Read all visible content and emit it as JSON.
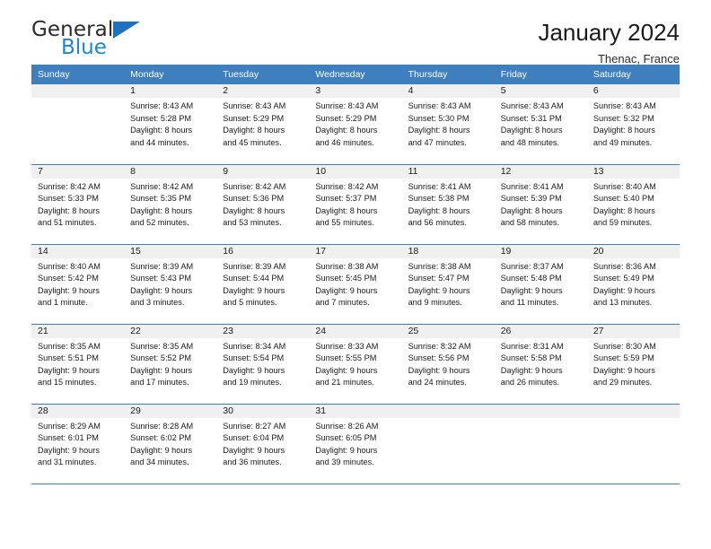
{
  "brand": {
    "name_top": "General",
    "name_bottom": "Blue",
    "flag_color": "#1f72bd",
    "blue_text_color": "#1f86d0"
  },
  "header": {
    "title": "January 2024",
    "subtitle": "Thenac, France"
  },
  "theme": {
    "header_row_bg": "#3d7fbf",
    "daynum_bg": "#f0f0f0",
    "grid_line": "#3d7fbf"
  },
  "calendar": {
    "weekday_headers": [
      "Sunday",
      "Monday",
      "Tuesday",
      "Wednesday",
      "Thursday",
      "Friday",
      "Saturday"
    ],
    "weeks": [
      [
        {
          "day": "",
          "lines": []
        },
        {
          "day": "1",
          "lines": [
            "Sunrise: 8:43 AM",
            "Sunset: 5:28 PM",
            "Daylight: 8 hours",
            "and 44 minutes."
          ]
        },
        {
          "day": "2",
          "lines": [
            "Sunrise: 8:43 AM",
            "Sunset: 5:29 PM",
            "Daylight: 8 hours",
            "and 45 minutes."
          ]
        },
        {
          "day": "3",
          "lines": [
            "Sunrise: 8:43 AM",
            "Sunset: 5:29 PM",
            "Daylight: 8 hours",
            "and 46 minutes."
          ]
        },
        {
          "day": "4",
          "lines": [
            "Sunrise: 8:43 AM",
            "Sunset: 5:30 PM",
            "Daylight: 8 hours",
            "and 47 minutes."
          ]
        },
        {
          "day": "5",
          "lines": [
            "Sunrise: 8:43 AM",
            "Sunset: 5:31 PM",
            "Daylight: 8 hours",
            "and 48 minutes."
          ]
        },
        {
          "day": "6",
          "lines": [
            "Sunrise: 8:43 AM",
            "Sunset: 5:32 PM",
            "Daylight: 8 hours",
            "and 49 minutes."
          ]
        }
      ],
      [
        {
          "day": "7",
          "lines": [
            "Sunrise: 8:42 AM",
            "Sunset: 5:33 PM",
            "Daylight: 8 hours",
            "and 51 minutes."
          ]
        },
        {
          "day": "8",
          "lines": [
            "Sunrise: 8:42 AM",
            "Sunset: 5:35 PM",
            "Daylight: 8 hours",
            "and 52 minutes."
          ]
        },
        {
          "day": "9",
          "lines": [
            "Sunrise: 8:42 AM",
            "Sunset: 5:36 PM",
            "Daylight: 8 hours",
            "and 53 minutes."
          ]
        },
        {
          "day": "10",
          "lines": [
            "Sunrise: 8:42 AM",
            "Sunset: 5:37 PM",
            "Daylight: 8 hours",
            "and 55 minutes."
          ]
        },
        {
          "day": "11",
          "lines": [
            "Sunrise: 8:41 AM",
            "Sunset: 5:38 PM",
            "Daylight: 8 hours",
            "and 56 minutes."
          ]
        },
        {
          "day": "12",
          "lines": [
            "Sunrise: 8:41 AM",
            "Sunset: 5:39 PM",
            "Daylight: 8 hours",
            "and 58 minutes."
          ]
        },
        {
          "day": "13",
          "lines": [
            "Sunrise: 8:40 AM",
            "Sunset: 5:40 PM",
            "Daylight: 8 hours",
            "and 59 minutes."
          ]
        }
      ],
      [
        {
          "day": "14",
          "lines": [
            "Sunrise: 8:40 AM",
            "Sunset: 5:42 PM",
            "Daylight: 9 hours",
            "and 1 minute."
          ]
        },
        {
          "day": "15",
          "lines": [
            "Sunrise: 8:39 AM",
            "Sunset: 5:43 PM",
            "Daylight: 9 hours",
            "and 3 minutes."
          ]
        },
        {
          "day": "16",
          "lines": [
            "Sunrise: 8:39 AM",
            "Sunset: 5:44 PM",
            "Daylight: 9 hours",
            "and 5 minutes."
          ]
        },
        {
          "day": "17",
          "lines": [
            "Sunrise: 8:38 AM",
            "Sunset: 5:45 PM",
            "Daylight: 9 hours",
            "and 7 minutes."
          ]
        },
        {
          "day": "18",
          "lines": [
            "Sunrise: 8:38 AM",
            "Sunset: 5:47 PM",
            "Daylight: 9 hours",
            "and 9 minutes."
          ]
        },
        {
          "day": "19",
          "lines": [
            "Sunrise: 8:37 AM",
            "Sunset: 5:48 PM",
            "Daylight: 9 hours",
            "and 11 minutes."
          ]
        },
        {
          "day": "20",
          "lines": [
            "Sunrise: 8:36 AM",
            "Sunset: 5:49 PM",
            "Daylight: 9 hours",
            "and 13 minutes."
          ]
        }
      ],
      [
        {
          "day": "21",
          "lines": [
            "Sunrise: 8:35 AM",
            "Sunset: 5:51 PM",
            "Daylight: 9 hours",
            "and 15 minutes."
          ]
        },
        {
          "day": "22",
          "lines": [
            "Sunrise: 8:35 AM",
            "Sunset: 5:52 PM",
            "Daylight: 9 hours",
            "and 17 minutes."
          ]
        },
        {
          "day": "23",
          "lines": [
            "Sunrise: 8:34 AM",
            "Sunset: 5:54 PM",
            "Daylight: 9 hours",
            "and 19 minutes."
          ]
        },
        {
          "day": "24",
          "lines": [
            "Sunrise: 8:33 AM",
            "Sunset: 5:55 PM",
            "Daylight: 9 hours",
            "and 21 minutes."
          ]
        },
        {
          "day": "25",
          "lines": [
            "Sunrise: 8:32 AM",
            "Sunset: 5:56 PM",
            "Daylight: 9 hours",
            "and 24 minutes."
          ]
        },
        {
          "day": "26",
          "lines": [
            "Sunrise: 8:31 AM",
            "Sunset: 5:58 PM",
            "Daylight: 9 hours",
            "and 26 minutes."
          ]
        },
        {
          "day": "27",
          "lines": [
            "Sunrise: 8:30 AM",
            "Sunset: 5:59 PM",
            "Daylight: 9 hours",
            "and 29 minutes."
          ]
        }
      ],
      [
        {
          "day": "28",
          "lines": [
            "Sunrise: 8:29 AM",
            "Sunset: 6:01 PM",
            "Daylight: 9 hours",
            "and 31 minutes."
          ]
        },
        {
          "day": "29",
          "lines": [
            "Sunrise: 8:28 AM",
            "Sunset: 6:02 PM",
            "Daylight: 9 hours",
            "and 34 minutes."
          ]
        },
        {
          "day": "30",
          "lines": [
            "Sunrise: 8:27 AM",
            "Sunset: 6:04 PM",
            "Daylight: 9 hours",
            "and 36 minutes."
          ]
        },
        {
          "day": "31",
          "lines": [
            "Sunrise: 8:26 AM",
            "Sunset: 6:05 PM",
            "Daylight: 9 hours",
            "and 39 minutes."
          ]
        },
        {
          "day": "",
          "lines": []
        },
        {
          "day": "",
          "lines": []
        },
        {
          "day": "",
          "lines": []
        }
      ]
    ]
  }
}
